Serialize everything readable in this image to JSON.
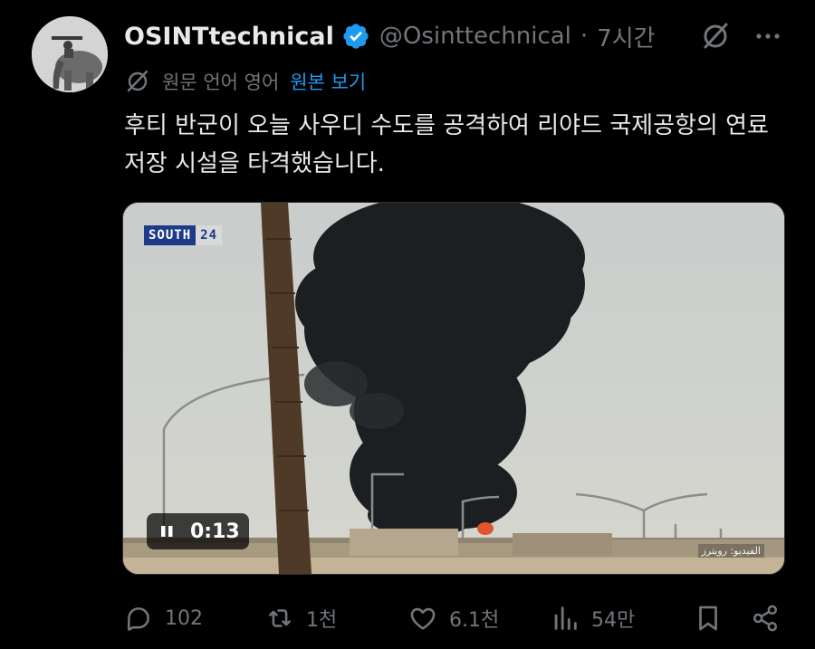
{
  "tweet": {
    "display_name": "OSINTtechnical",
    "handle": "@Osinttechnical",
    "separator": "·",
    "time": "7시간",
    "translation": {
      "label": "원문 언어 영어",
      "link": "원본 보기"
    },
    "text": "후티 반군이 오늘 사우디 수도를 공격하여 리야드 국제공항의 연료 저장 시설을 타격했습니다."
  },
  "media": {
    "watermark_left": "SOUTH",
    "watermark_right": "24",
    "credit": "الفيديو: رويترز",
    "player_time": "0:13"
  },
  "actions": {
    "replies": "102",
    "reposts": "1천",
    "likes": "6.1천",
    "views": "54만"
  },
  "icons": {
    "verified_color": "#1d9bf0",
    "accent_color": "#1d9bf0",
    "muted_color": "#71767b"
  }
}
